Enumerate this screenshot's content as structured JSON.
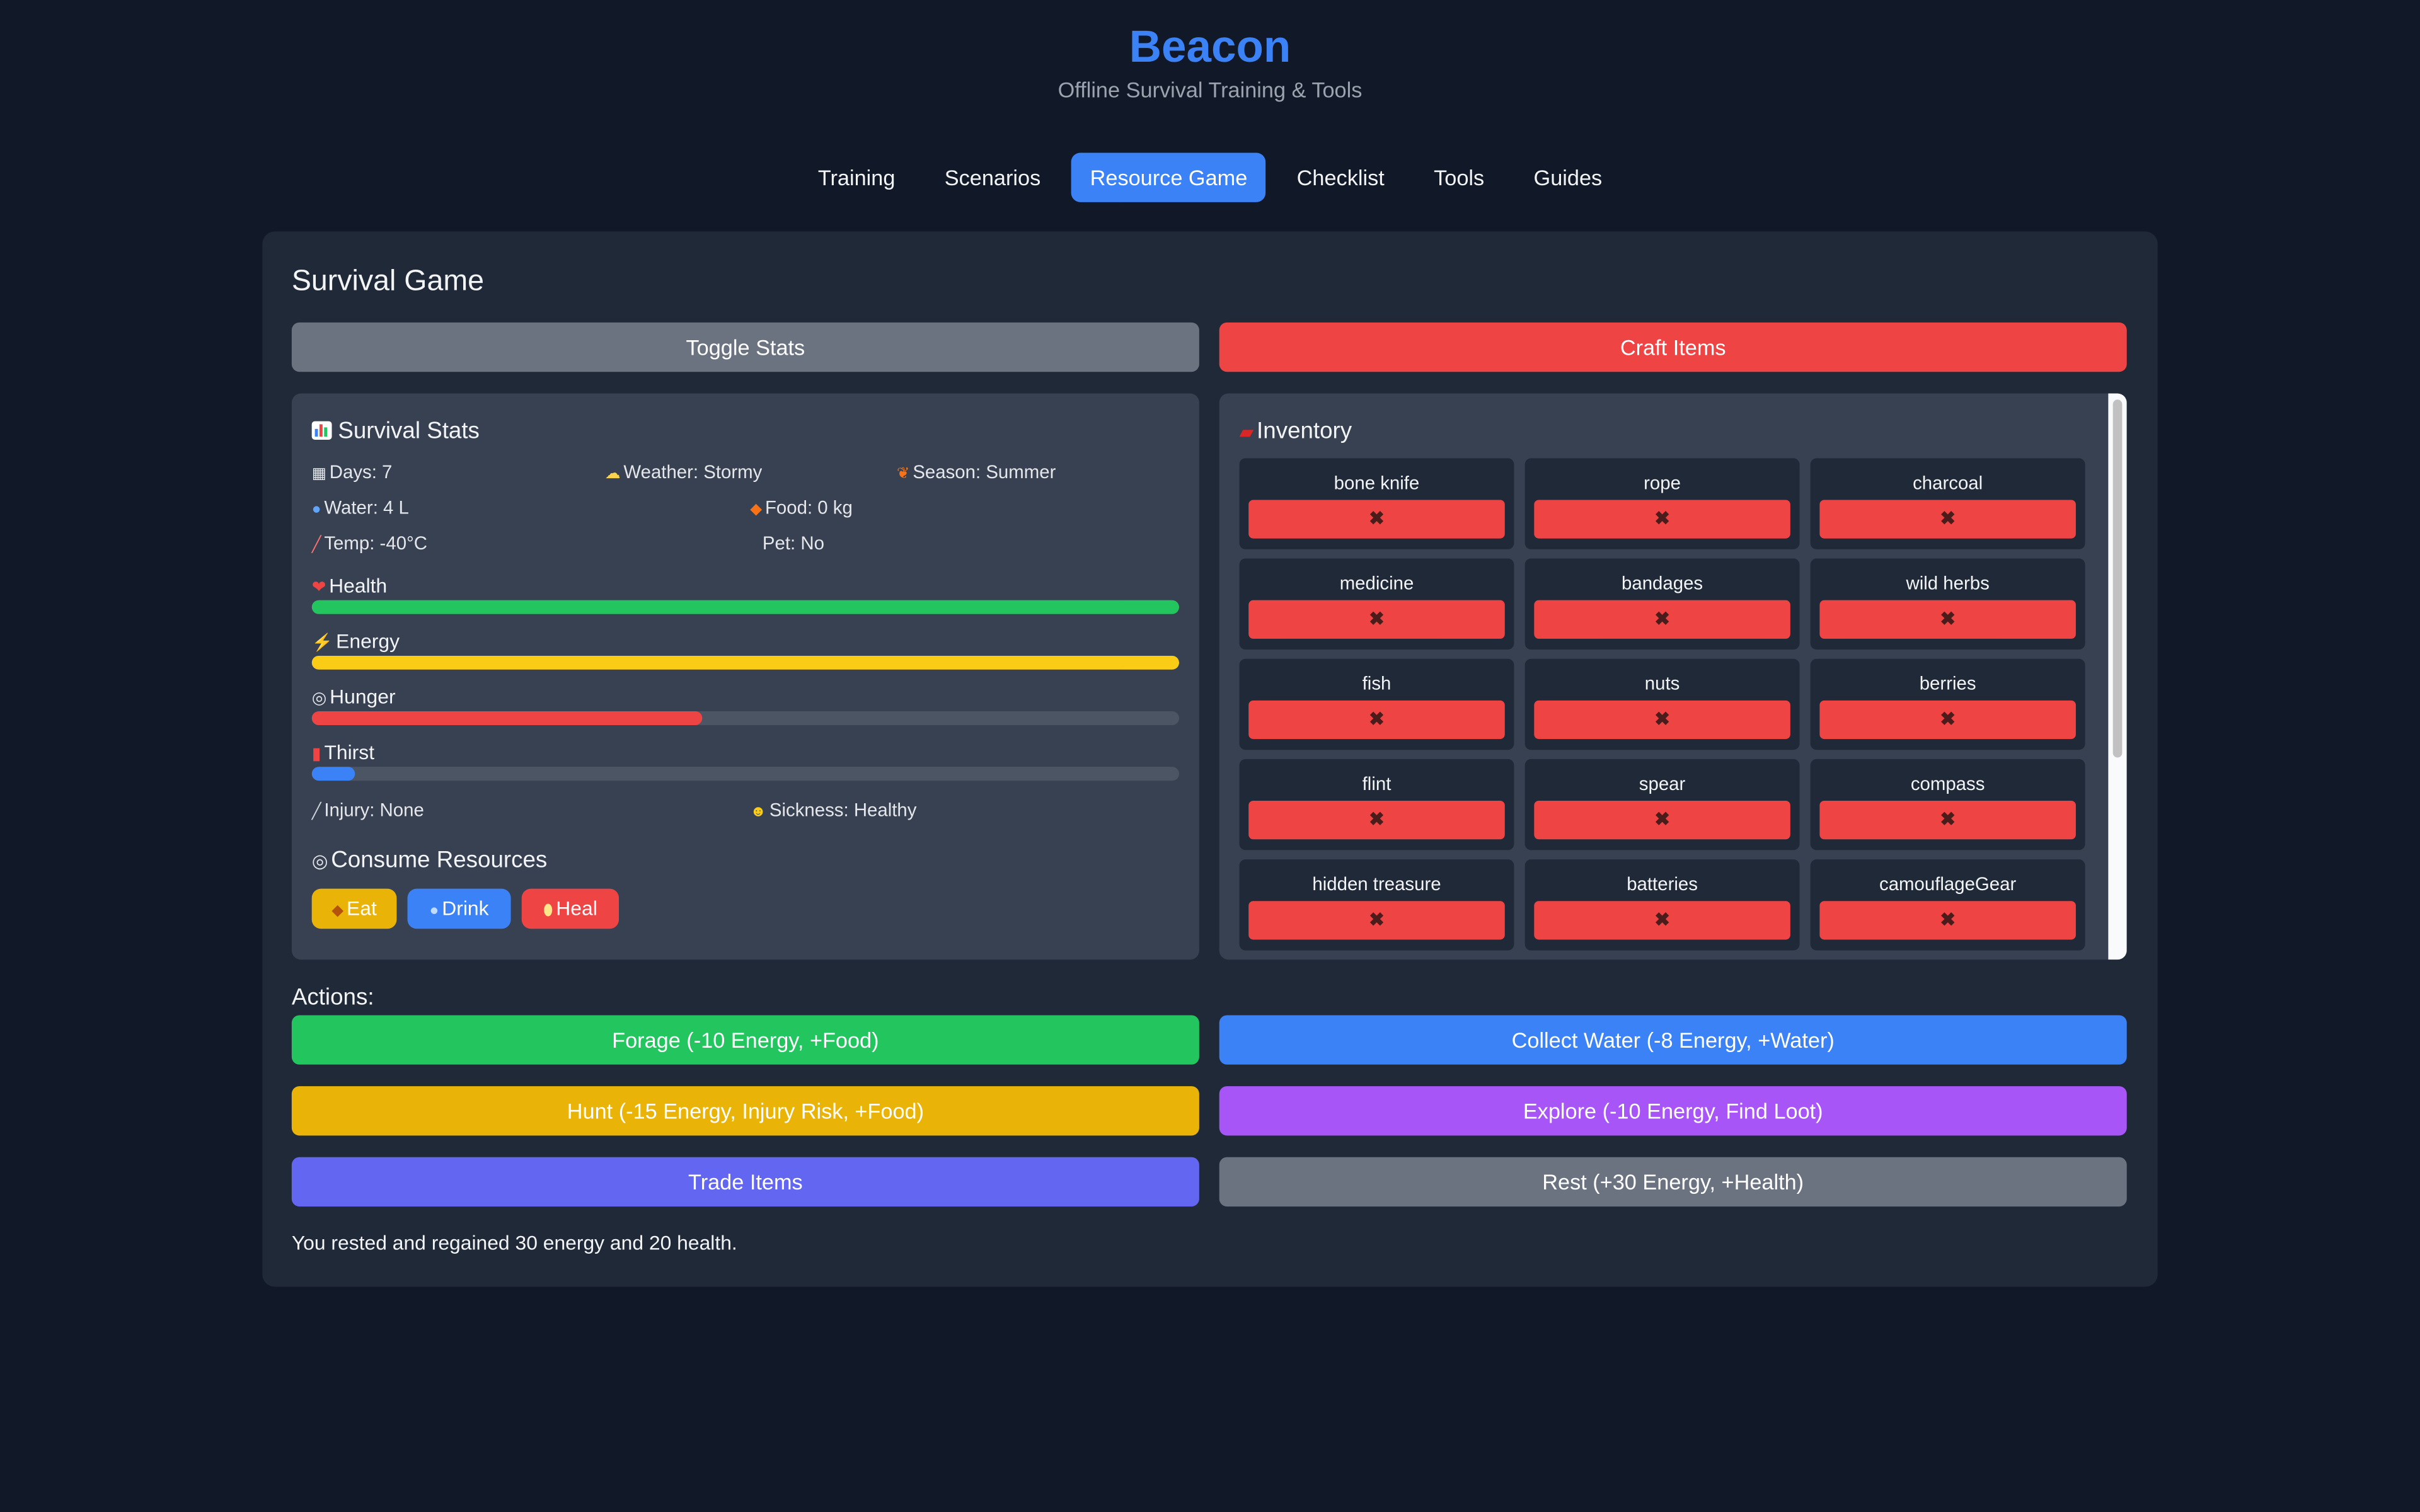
{
  "app": {
    "title": "Beacon",
    "subtitle": "Offline Survival Training & Tools"
  },
  "nav": {
    "tabs": [
      "Training",
      "Scenarios",
      "Resource Game",
      "Checklist",
      "Tools",
      "Guides"
    ],
    "active": "Resource Game"
  },
  "game": {
    "title": "Survival Game",
    "toggle_stats_label": "Toggle Stats",
    "craft_items_label": "Craft Items",
    "stats": {
      "title": "Survival Stats",
      "days": "Days: 7",
      "weather": "Weather: Stormy",
      "season": "Season: Summer",
      "water": "Water: 4 L",
      "food": "Food: 0 kg",
      "temp": "Temp: -40°C",
      "pet": "Pet: No",
      "injury": "Injury: None",
      "sickness": "Sickness: Healthy"
    },
    "bars": [
      {
        "label": "Health",
        "percent": 100,
        "color": "#22c55e"
      },
      {
        "label": "Energy",
        "percent": 100,
        "color": "#facc15"
      },
      {
        "label": "Hunger",
        "percent": 45,
        "color": "#ef4444"
      },
      {
        "label": "Thirst",
        "percent": 5,
        "color": "#3b82f6"
      }
    ],
    "consume": {
      "title": "Consume Resources",
      "eat": "Eat",
      "drink": "Drink",
      "heal": "Heal"
    },
    "inventory": {
      "title": "Inventory",
      "remove_glyph": "✖",
      "items": [
        "bone knife",
        "rope",
        "charcoal",
        "medicine",
        "bandages",
        "wild herbs",
        "fish",
        "nuts",
        "berries",
        "flint",
        "spear",
        "compass",
        "hidden treasure",
        "batteries",
        "camouflageGear"
      ]
    },
    "actions_label": "Actions:",
    "actions": {
      "forage": "Forage (-10 Energy, +Food)",
      "collect_water": "Collect Water (-8 Energy, +Water)",
      "hunt": "Hunt (-15 Energy, Injury Risk, +Food)",
      "explore": "Explore (-10 Energy, Find Loot)",
      "trade": "Trade Items",
      "rest": "Rest (+30 Energy, +Health)"
    },
    "status_message": "You rested and regained 30 energy and 20 health."
  },
  "colors": {
    "background": "#111827",
    "card": "#1f2937",
    "panel": "#374151",
    "accent": "#3b82f6",
    "danger": "#ef4444",
    "success": "#22c55e",
    "warning": "#eab308",
    "purple": "#a855f7",
    "indigo": "#6366f1",
    "gray": "#6b7280"
  },
  "icons": {
    "stats": "bar-chart-icon",
    "days": "calendar-icon",
    "weather": "cloud-sun-icon",
    "season": "leaf-icon",
    "water": "droplet-icon",
    "food": "meat-icon",
    "temp": "thermometer-icon",
    "pet": "paw-icon",
    "health": "heart-icon",
    "energy": "lightning-icon",
    "hunger": "plate-icon",
    "thirst": "cup-icon",
    "injury": "bandage-icon",
    "sickness": "face-icon",
    "inventory": "backpack-icon"
  }
}
